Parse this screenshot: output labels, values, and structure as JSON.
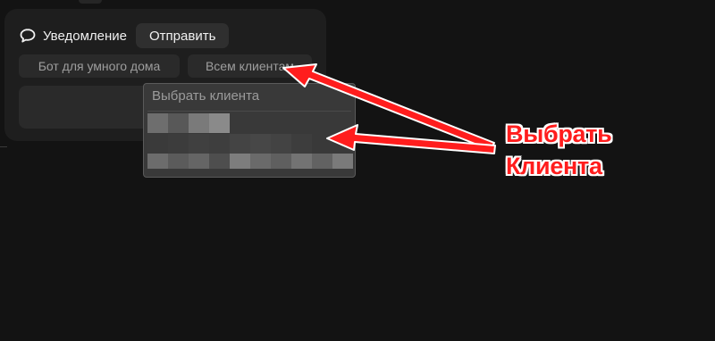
{
  "notification": {
    "icon": "chat-bubble-icon",
    "title": "Уведомление",
    "send_label": "Отправить",
    "targets": [
      "Бот для умного дома",
      "Всем клиентам"
    ]
  },
  "client_dropdown": {
    "placeholder": "Выбрать клиента",
    "options": [
      {
        "pixel_shades": [
          "#6e6e6e",
          "#585858",
          "#7a7a7a",
          "#8a8a8a"
        ]
      },
      {
        "pixel_shades": [
          "#3a3a3a",
          "#3c3c3c",
          "#404040",
          "#3e3e3e",
          "#444444",
          "#474747",
          "#434343",
          "#3d3d3d"
        ]
      },
      {
        "pixel_shades": [
          "#6c6c6c",
          "#5b5b5b",
          "#656565",
          "#4e4e4e",
          "#7d7d7d",
          "#6a6a6a",
          "#5f5f5f",
          "#737373",
          "#626262",
          "#7a7a7a"
        ]
      }
    ]
  },
  "annotation": {
    "line1": "Выбрать",
    "line2": "Клиента",
    "color": "#ff1d1d"
  }
}
